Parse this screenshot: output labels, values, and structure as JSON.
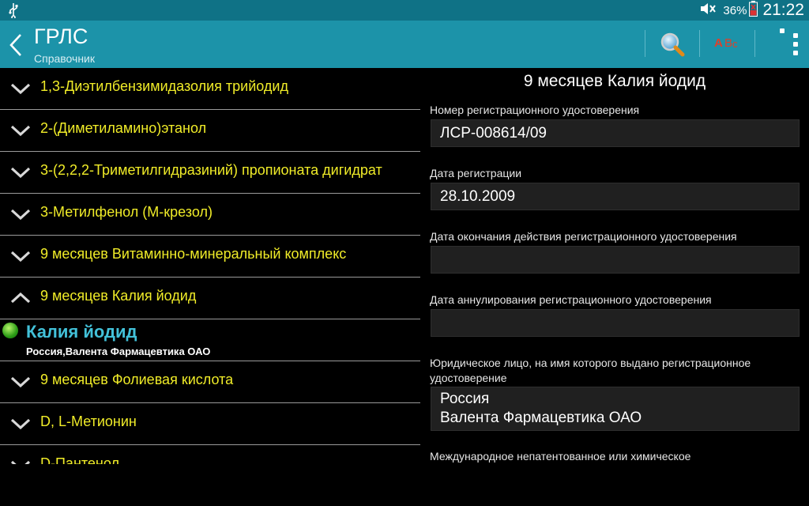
{
  "status_bar": {
    "battery_percent": "36%",
    "time": "21:22"
  },
  "action_bar": {
    "title": "ГРЛС",
    "subtitle": "Справочник"
  },
  "list": {
    "items": [
      {
        "label": "1,3-Диэтилбензимидазолия трийодид",
        "expanded": false
      },
      {
        "label": "2-(Диметиламино)этанол",
        "expanded": false
      },
      {
        "label": "3-(2,2,2-Триметилгидразиний) пропионата дигидрат",
        "expanded": false
      },
      {
        "label": "3-Метилфенол (М-крезол)",
        "expanded": false
      },
      {
        "label": "9 месяцев Витаминно-минеральный комплекс",
        "expanded": false
      },
      {
        "label": "9 месяцев Калия йодид",
        "expanded": true
      },
      {
        "label": "9 месяцев Фолиевая кислота",
        "expanded": false
      },
      {
        "label": "D, L-Метионин",
        "expanded": false
      },
      {
        "label": "D-Пантенол",
        "expanded": false
      }
    ],
    "expanded_child": {
      "name": "Калия йодид",
      "maker": "Россия,Валента Фармацевтика ОАО"
    }
  },
  "detail": {
    "title": "9 месяцев Калия йодид",
    "reg_number_label": "Номер регистрационного удостоверения",
    "reg_number_value": "ЛСР-008614/09",
    "reg_date_label": "Дата регистрации",
    "reg_date_value": "28.10.2009",
    "expiry_label": "Дата окончания действия регистрационного удостоверения",
    "expiry_value": "",
    "cancel_label": "Дата аннулирования регистрационного удостоверения",
    "cancel_value": "",
    "holder_label_1": "Юридическое лицо, на имя которого выдано регистрационное",
    "holder_label_2": "удостоверение",
    "holder_value_1": "Россия",
    "holder_value_2": "Валента Фармацевтика ОАО",
    "inn_label": "Международное непатентованное или химическое"
  },
  "colors": {
    "status_bar": "#0f7286",
    "action_bar": "#1c93a9",
    "list_text": "#f0ec28",
    "child_name": "#42c1d9",
    "field_box": "#202020"
  },
  "icons": [
    "usb-icon",
    "mute-icon",
    "battery-icon",
    "back-icon",
    "search-icon",
    "spellcheck-icon",
    "overflow-menu-icon",
    "chevron-down-icon",
    "chevron-up-icon",
    "status-dot-icon"
  ]
}
